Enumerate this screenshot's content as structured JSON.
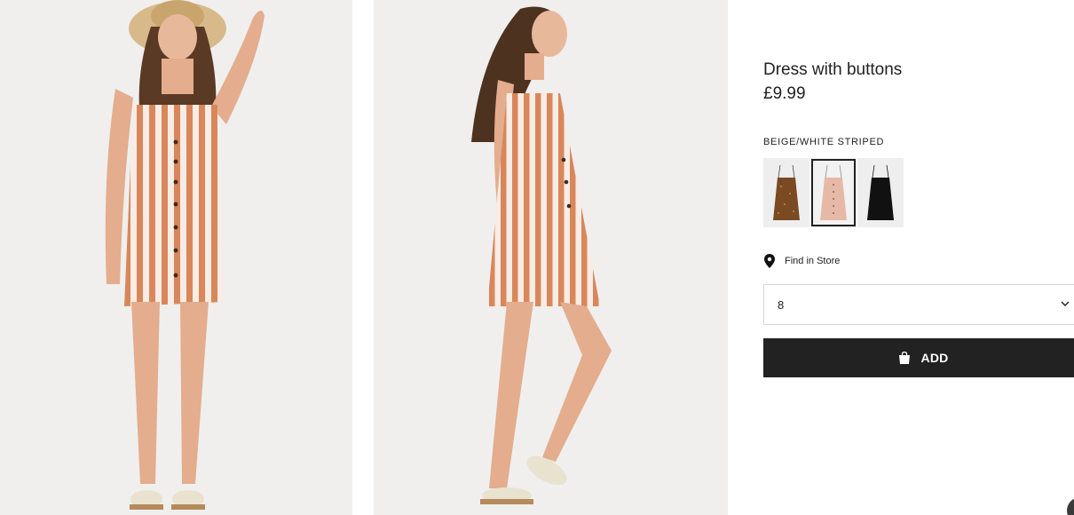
{
  "product": {
    "title": "Dress with buttons",
    "price": "£9.99",
    "color_label": "BEIGE/WHITE STRIPED"
  },
  "images": [
    {
      "alt": "model-front-view",
      "background": "#f0efee"
    },
    {
      "alt": "model-side-view",
      "background": "#f0efee"
    }
  ],
  "swatches": [
    {
      "name": "brown-patterned",
      "color": "#7a4a22",
      "selected": false
    },
    {
      "name": "beige-white-striped",
      "color": "#e6b9a6",
      "selected": true
    },
    {
      "name": "black",
      "color": "#111111",
      "selected": false
    }
  ],
  "store": {
    "find_in_store_label": "Find in Store",
    "icon": "map-pin-icon"
  },
  "size_select": {
    "value": "8",
    "icon": "chevron-down-icon"
  },
  "add_button": {
    "label": "ADD",
    "icon": "shopping-bag-icon"
  },
  "colors": {
    "button_bg": "#222222",
    "stripe_orange": "#d9875a",
    "stripe_white": "#f7ece6",
    "photo_bg": "#f0efee"
  }
}
